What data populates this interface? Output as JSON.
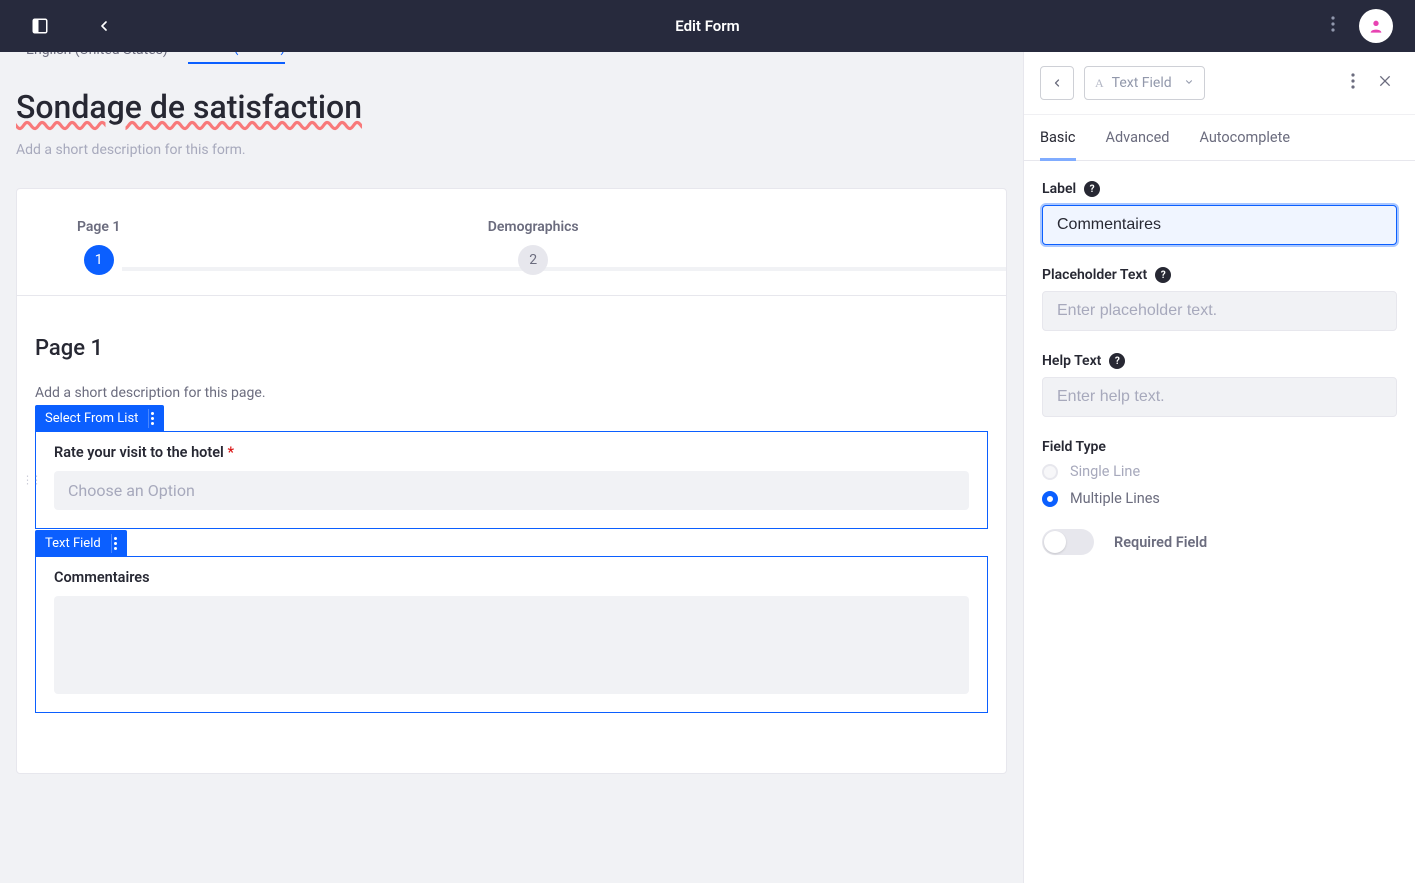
{
  "app": {
    "title": "Edit Form"
  },
  "langs": {
    "inactive": "English (United States)",
    "active": "French (France)"
  },
  "form": {
    "title": "Sondage de satisfaction",
    "desc_placeholder": "Add a short description for this form."
  },
  "pages": {
    "steps": [
      {
        "label": "Page 1",
        "num": "1",
        "active": true
      },
      {
        "label": "Demographics",
        "num": "2",
        "active": false
      }
    ],
    "current": {
      "heading": "Page 1",
      "desc": "Add a short description for this page."
    }
  },
  "fields": {
    "select": {
      "tag": "Select From List",
      "label": "Rate your visit to the hotel",
      "required": true,
      "placeholder": "Choose an Option"
    },
    "text": {
      "tag": "Text Field",
      "label": "Commentaires"
    }
  },
  "panel": {
    "type_label": "Text Field",
    "tabs": {
      "basic": "Basic",
      "advanced": "Advanced",
      "autocomplete": "Autocomplete"
    },
    "label_field": {
      "label": "Label",
      "value": "Commentaires"
    },
    "placeholder_field": {
      "label": "Placeholder Text",
      "placeholder": "Enter placeholder text."
    },
    "help_field": {
      "label": "Help Text",
      "placeholder": "Enter help text."
    },
    "field_type": {
      "label": "Field Type",
      "single": "Single Line",
      "multiple": "Multiple Lines"
    },
    "required": {
      "label": "Required Field"
    }
  }
}
